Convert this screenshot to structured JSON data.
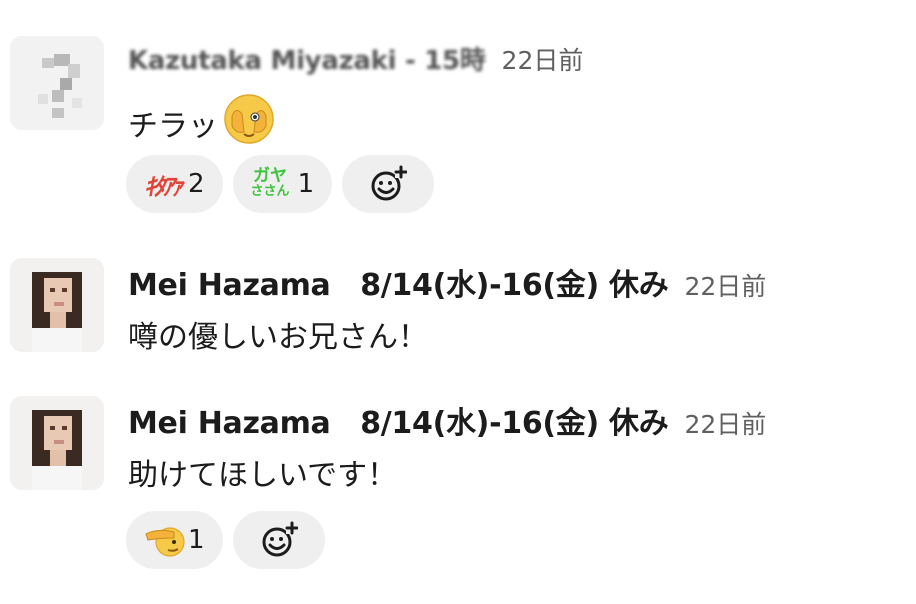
{
  "messages": [
    {
      "author": "Kazutaka Miyazaki - 15時",
      "time": "22日前",
      "text": "チラッ",
      "reactions": [
        {
          "emoji": "kitaaa-custom-emoji",
          "label": "ｷﾀｱｧ",
          "count": "2"
        },
        {
          "emoji": "gaya-custom-emoji",
          "label": "ガヤ",
          "label2": "ささん",
          "count": "1"
        }
      ],
      "add_reaction": "add-reaction"
    },
    {
      "author": "Mei Hazama　8/14(水)-16(金) 休み",
      "time": "22日前",
      "text": "噂の優しいお兄さん！"
    },
    {
      "author": "Mei Hazama　8/14(水)-16(金) 休み",
      "time": "22日前",
      "text": "助けてほしいです！",
      "reactions": [
        {
          "emoji": "saluting-face-emoji",
          "count": "1"
        }
      ],
      "add_reaction": "add-reaction"
    }
  ],
  "colors": {
    "pill_bg": "#efefef",
    "kitaaa_red": "#e0453a",
    "gaya_green": "#3cc43c",
    "timestamp": "#616061"
  }
}
